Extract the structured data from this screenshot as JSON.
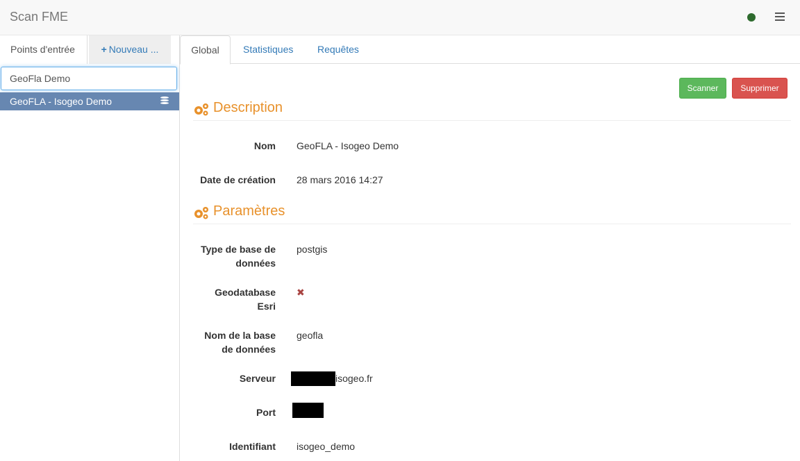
{
  "app": {
    "title": "Scan FME",
    "status_color": "#2e6b2e"
  },
  "left": {
    "tabs": [
      "Points d'entrée",
      "Nouveau ..."
    ],
    "search_value": "GeoFla Demo",
    "items": [
      {
        "label": "GeoFLA - Isogeo Demo",
        "icon": "database-icon"
      }
    ]
  },
  "main": {
    "tabs": [
      "Global",
      "Statistiques",
      "Requêtes"
    ],
    "buttons": {
      "scan": "Scanner",
      "delete": "Supprimer"
    },
    "sections": {
      "description": "Description",
      "parameters": "Paramètres"
    },
    "fields": {
      "nom": {
        "label": "Nom",
        "value": "GeoFLA - Isogeo Demo"
      },
      "date": {
        "label": "Date de création",
        "value": "28 mars 2016 14:27"
      },
      "dbtype": {
        "label": "Type de base de données",
        "value": "postgis"
      },
      "geodatabase": {
        "label": "Geodatabase Esri",
        "value": "✖"
      },
      "dbname": {
        "label": "Nom de la base de données",
        "value": "geofla"
      },
      "server": {
        "label": "Serveur",
        "value": "isogeo.fr"
      },
      "port": {
        "label": "Port",
        "value": ""
      },
      "identifiant": {
        "label": "Identifiant",
        "value": "isogeo_demo"
      }
    }
  }
}
